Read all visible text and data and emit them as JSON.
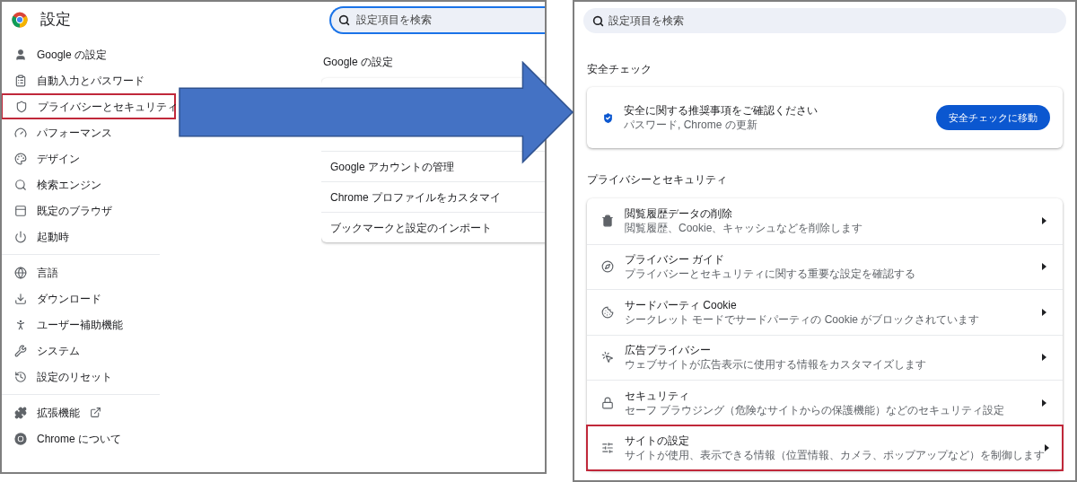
{
  "left_screen": {
    "title": "設定",
    "search": {
      "placeholder": "設定項目を検索"
    },
    "sidebar": {
      "groups": [
        {
          "items": [
            {
              "label": "Google の設定",
              "highlighted": false
            },
            {
              "label": "自動入力とパスワード",
              "highlighted": false
            },
            {
              "label": "プライバシーとセキュリティ",
              "highlighted": true
            },
            {
              "label": "パフォーマンス",
              "highlighted": false
            },
            {
              "label": "デザイン",
              "highlighted": false
            },
            {
              "label": "検索エンジン",
              "highlighted": false
            },
            {
              "label": "既定のブラウザ",
              "highlighted": false
            },
            {
              "label": "起動時",
              "highlighted": false
            }
          ]
        },
        {
          "items": [
            {
              "label": "言語",
              "highlighted": false
            },
            {
              "label": "ダウンロード",
              "highlighted": false
            },
            {
              "label": "ユーザー補助機能",
              "highlighted": false
            },
            {
              "label": "システム",
              "highlighted": false
            },
            {
              "label": "設定のリセット",
              "highlighted": false
            }
          ]
        },
        {
          "items": [
            {
              "label": "拡張機能",
              "highlighted": false,
              "external": true
            },
            {
              "label": "Chrome について",
              "highlighted": false,
              "external": false
            }
          ]
        }
      ]
    },
    "section_title": "Google の設定",
    "card_rows": [
      "Google アカウントの管理",
      "Chrome プロファイルをカスタマイ",
      "ブックマークと設定のインポート"
    ]
  },
  "right_screen": {
    "search": {
      "placeholder": "設定項目を検索"
    },
    "safety_check": {
      "heading": "安全チェック",
      "title": "安全に関する推奨事項をご確認ください",
      "subtitle": "パスワード, Chrome の更新",
      "button": "安全チェックに移動"
    },
    "privacy": {
      "heading": "プライバシーとセキュリティ",
      "rows": [
        {
          "title": "閲覧履歴データの削除",
          "subtitle": "閲覧履歴、Cookie、キャッシュなどを削除します",
          "highlighted": false
        },
        {
          "title": "プライバシー ガイド",
          "subtitle": "プライバシーとセキュリティに関する重要な設定を確認する",
          "highlighted": false
        },
        {
          "title": "サードパーティ Cookie",
          "subtitle": "シークレット モードでサードパーティの Cookie がブロックされています",
          "highlighted": false
        },
        {
          "title": "広告プライバシー",
          "subtitle": "ウェブサイトが広告表示に使用する情報をカスタマイズします",
          "highlighted": false
        },
        {
          "title": "セキュリティ",
          "subtitle": "セーフ ブラウジング（危険なサイトからの保護機能）などのセキュリティ設定",
          "highlighted": false
        },
        {
          "title": "サイトの設定",
          "subtitle": "サイトが使用、表示できる情報（位置情報、カメラ、ポップアップなど）を制御します",
          "highlighted": true
        }
      ]
    }
  }
}
